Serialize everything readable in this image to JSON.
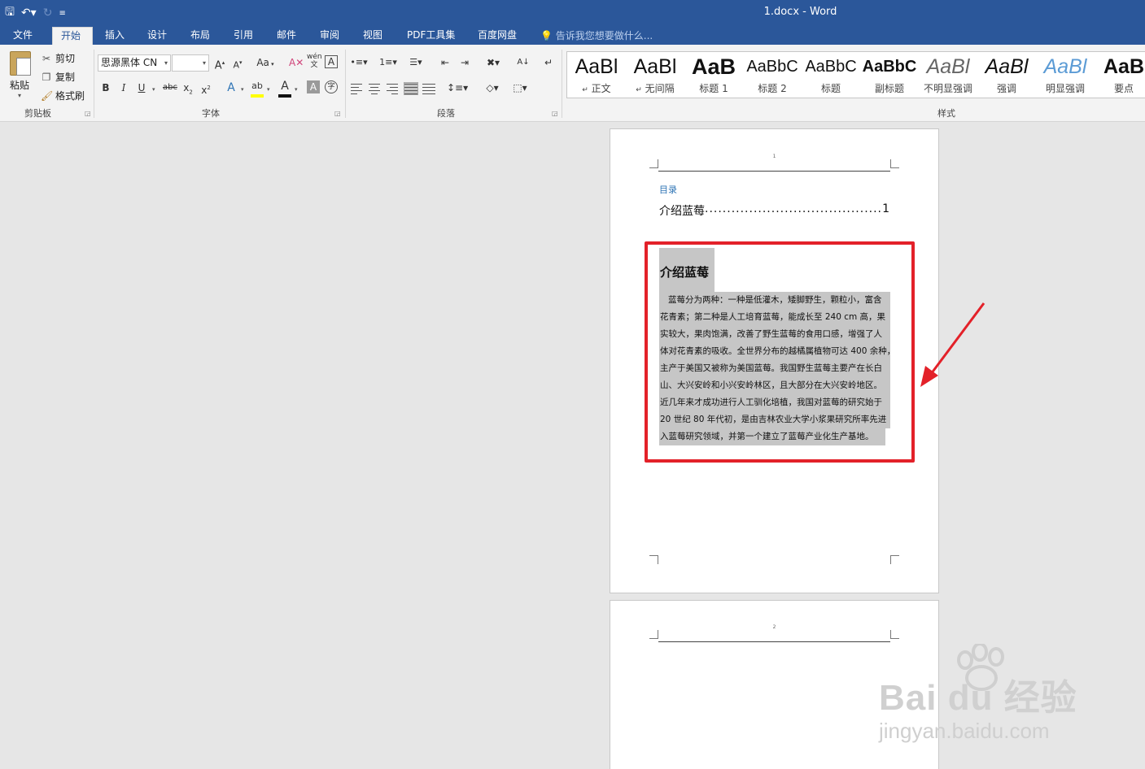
{
  "window": {
    "title": "1.docx - Word"
  },
  "tabs": [
    {
      "label": "文件"
    },
    {
      "label": "开始"
    },
    {
      "label": "插入"
    },
    {
      "label": "设计"
    },
    {
      "label": "布局"
    },
    {
      "label": "引用"
    },
    {
      "label": "邮件"
    },
    {
      "label": "审阅"
    },
    {
      "label": "视图"
    },
    {
      "label": "PDF工具集"
    },
    {
      "label": "百度网盘"
    }
  ],
  "tell_me": "告诉我您想要做什么...",
  "clipboard": {
    "paste": "粘贴",
    "cut": "剪切",
    "copy": "复制",
    "format_painter": "格式刷",
    "group": "剪贴板"
  },
  "font": {
    "name": "思源黑体 CN",
    "size": "",
    "group": "字体",
    "change_case": "Aa"
  },
  "paragraph": {
    "group": "段落"
  },
  "styles": {
    "group": "样式",
    "items": [
      {
        "sample": "AaBl",
        "name": "正文",
        "mark": "↵"
      },
      {
        "sample": "AaBl",
        "name": "无间隔",
        "mark": "↵"
      },
      {
        "sample": "AaB",
        "name": "标题 1"
      },
      {
        "sample": "AaBbC",
        "name": "标题 2"
      },
      {
        "sample": "AaBbC",
        "name": "标题"
      },
      {
        "sample": "AaBbC",
        "name": "副标题"
      },
      {
        "sample": "AaBl",
        "name": "不明显强调"
      },
      {
        "sample": "AaBl",
        "name": "强调"
      },
      {
        "sample": "AaBl",
        "name": "明显强调"
      },
      {
        "sample": "AaB",
        "name": "要点"
      }
    ]
  },
  "document": {
    "page1_number": "1",
    "page2_number": "2",
    "toc_title": "目录",
    "toc_entry": {
      "text": "介绍蓝莓",
      "dots": "........................................................",
      "page": "1"
    },
    "heading": "介绍蓝莓",
    "body_lines": [
      "蓝莓分为两种：一种是低灌木，矮脚野生，颗粒小，富含",
      "花青素；第二种是人工培育蓝莓，能成长至 240 cm 高，果",
      "实较大，果肉饱满，改善了野生蓝莓的食用口感，增强了人",
      "体对花青素的吸收。全世界分布的越橘属植物可达 400 余种，",
      "主产于美国又被称为美国蓝莓。我国野生蓝莓主要产在长白",
      "山、大兴安岭和小兴安岭林区，且大部分在大兴安岭地区。",
      "近几年来才成功进行人工驯化培植，我国对蓝莓的研究始于",
      "20 世纪 80 年代初，是由吉林农业大学小浆果研究所率先进",
      "入蓝莓研究领域，并第一个建立了蓝莓产业化生产基地。"
    ]
  },
  "watermark": {
    "logo": "Bai du 经验",
    "url": "jingyan.baidu.com"
  },
  "colors": {
    "titlebar": "#2b579a",
    "highlight_box": "#e32129",
    "arrow": "#e32129",
    "selection": "#c6c6c6"
  }
}
